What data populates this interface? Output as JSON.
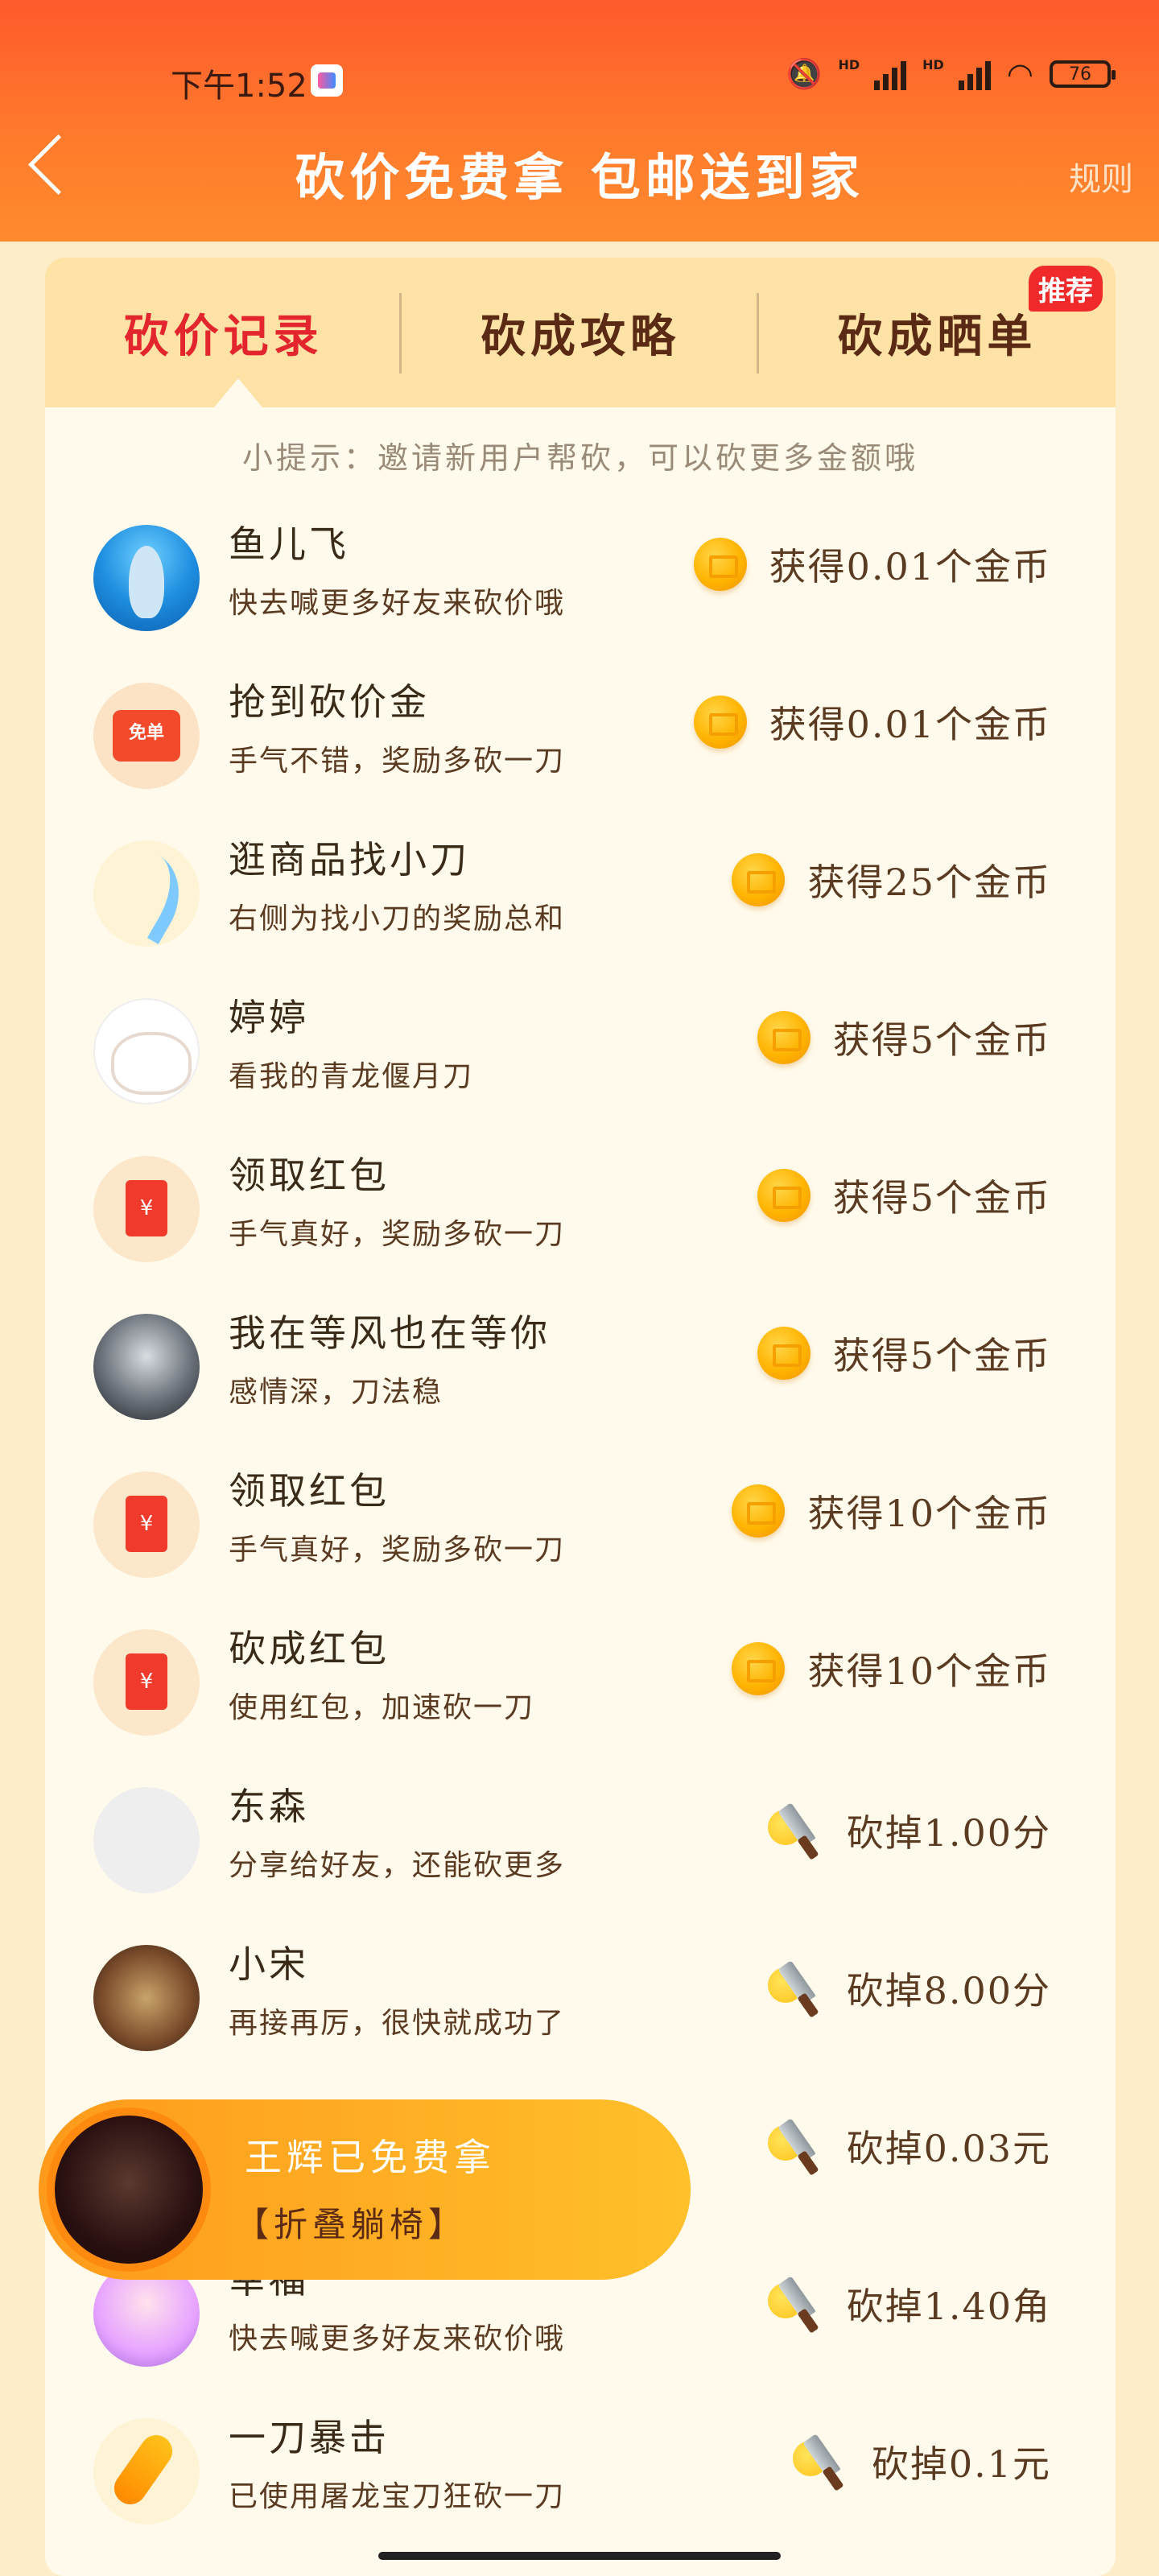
{
  "status_bar": {
    "time": "下午1:52",
    "network_label": "HD",
    "battery": "76"
  },
  "header": {
    "title": "砍价免费拿 包邮送到家",
    "rules": "规则"
  },
  "tabs": [
    {
      "label": "砍价记录",
      "active": true
    },
    {
      "label": "砍成攻略",
      "active": false
    },
    {
      "label": "砍成晒单",
      "active": false,
      "badge": "推荐"
    }
  ],
  "tip": "小提示：邀请新用户帮砍，可以砍更多金额哦",
  "records": [
    {
      "avatar": "dolphin-avatar",
      "name": "鱼儿飞",
      "desc": "快去喊更多好友来砍价哦",
      "reward_type": "coin",
      "reward": "获得0.01个金币"
    },
    {
      "avatar": "coupon-avatar",
      "avatar_text": "免单",
      "name": "抢到砍价金",
      "desc": "手气不错，奖励多砍一刀",
      "reward_type": "coin",
      "reward": "获得0.01个金币"
    },
    {
      "avatar": "sword-avatar",
      "name": "逛商品找小刀",
      "desc": "右侧为找小刀的奖励总和",
      "reward_type": "coin",
      "reward": "获得25个金币"
    },
    {
      "avatar": "cat-avatar",
      "name": "婷婷",
      "desc": "看我的青龙偃月刀",
      "reward_type": "coin",
      "reward": "获得5个金币"
    },
    {
      "avatar": "red-envelope-avatar",
      "avatar_text": "¥",
      "name": "领取红包",
      "desc": "手气真好，奖励多砍一刀",
      "reward_type": "coin",
      "reward": "获得5个金币"
    },
    {
      "avatar": "dark-avatar",
      "name": "我在等风也在等你",
      "desc": "感情深，刀法稳",
      "reward_type": "coin",
      "reward": "获得5个金币"
    },
    {
      "avatar": "red-envelope-avatar",
      "avatar_text": "¥",
      "name": "领取红包",
      "desc": "手气真好，奖励多砍一刀",
      "reward_type": "coin",
      "reward": "获得10个金币"
    },
    {
      "avatar": "red-envelope-avatar",
      "avatar_text": "¥",
      "name": "砍成红包",
      "desc": "使用红包，加速砍一刀",
      "reward_type": "coin",
      "reward": "获得10个金币"
    },
    {
      "avatar": "blank-avatar",
      "name": "东森",
      "desc": "分享给好友，还能砍更多",
      "reward_type": "knife",
      "reward": "砍掉1.00分"
    },
    {
      "avatar": "warrior-avatar",
      "name": "小宋",
      "desc": "再接再厉，很快就成功了",
      "reward_type": "knife",
      "reward": "砍掉8.00分"
    },
    {
      "avatar": "hidden-avatar",
      "name": "",
      "desc": "",
      "reward_type": "knife",
      "reward": "砍掉0.03元"
    },
    {
      "avatar": "girl-avatar",
      "name": "幸福",
      "desc": "快去喊更多好友来砍价哦",
      "reward_type": "knife",
      "reward": "砍掉1.40角"
    },
    {
      "avatar": "gold-avatar",
      "name": "一刀暴击",
      "desc": "已使用屠龙宝刀狂砍一刀",
      "reward_type": "knife",
      "reward": "砍掉0.1元"
    }
  ],
  "toast": {
    "title": "王辉已免费拿",
    "subtitle": "【折叠躺椅】"
  }
}
